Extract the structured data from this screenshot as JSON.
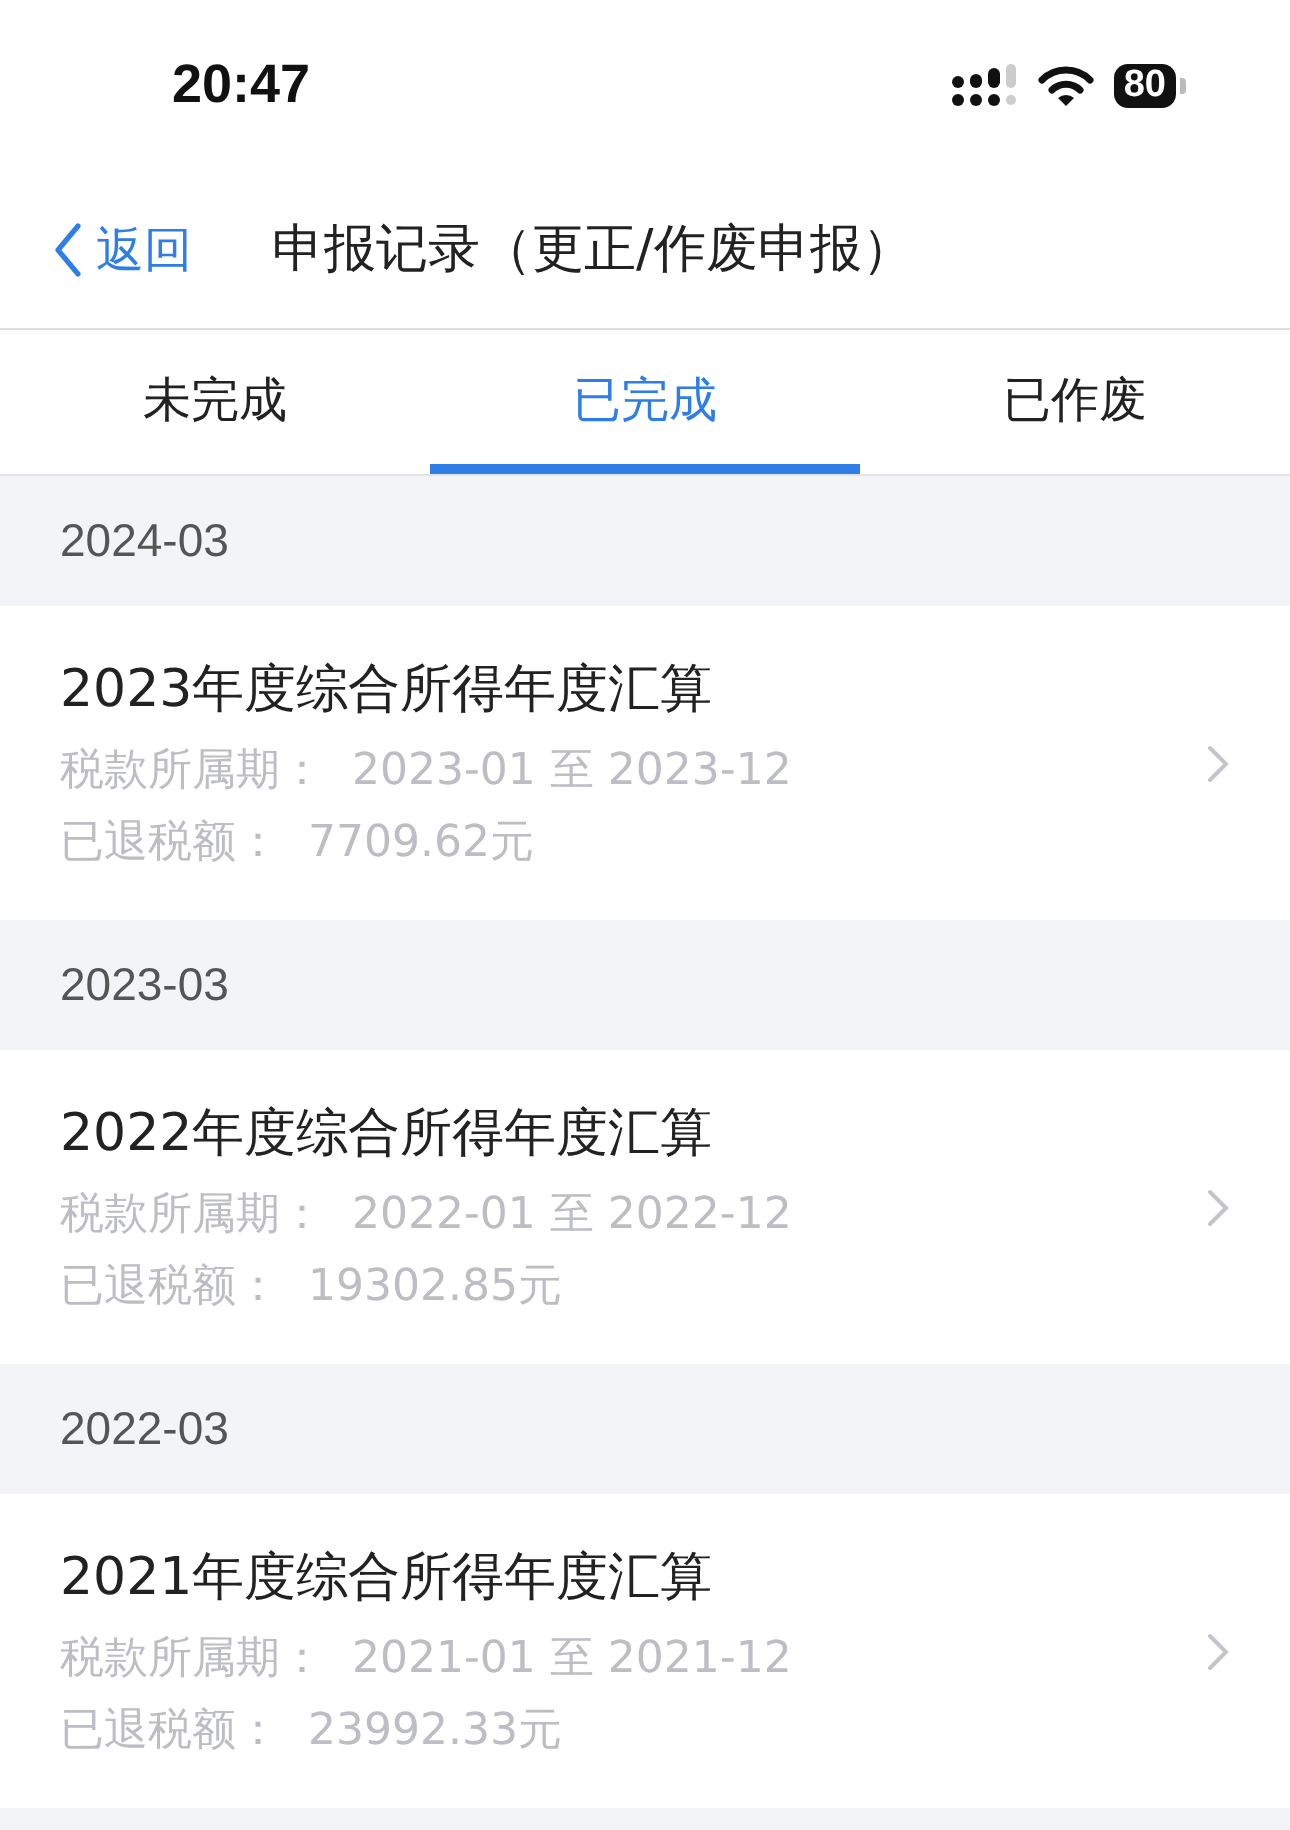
{
  "status_bar": {
    "time": "20:47",
    "battery": "80"
  },
  "nav": {
    "back": "返回",
    "title": "申报记录（更正/作废申报）"
  },
  "tabs": [
    {
      "label": "未完成",
      "selected": false
    },
    {
      "label": "已完成",
      "selected": true
    },
    {
      "label": "已作废",
      "selected": false
    }
  ],
  "groups": [
    {
      "date": "2024-03",
      "record": {
        "title": "2023年度综合所得年度汇算",
        "details": [
          {
            "label": "税款所属期：",
            "value": "2023-01 至 2023-12"
          },
          {
            "label": "已退税额：",
            "value": "7709.62元"
          }
        ]
      }
    },
    {
      "date": "2023-03",
      "record": {
        "title": "2022年度综合所得年度汇算",
        "details": [
          {
            "label": "税款所属期：",
            "value": "2022-01 至 2022-12"
          },
          {
            "label": "已退税额：",
            "value": "19302.85元"
          }
        ]
      }
    },
    {
      "date": "2022-03",
      "record": {
        "title": "2021年度综合所得年度汇算",
        "details": [
          {
            "label": "税款所属期：",
            "value": "2021-01 至 2021-12"
          },
          {
            "label": "已退税额：",
            "value": "23992.33元"
          }
        ]
      }
    }
  ]
}
